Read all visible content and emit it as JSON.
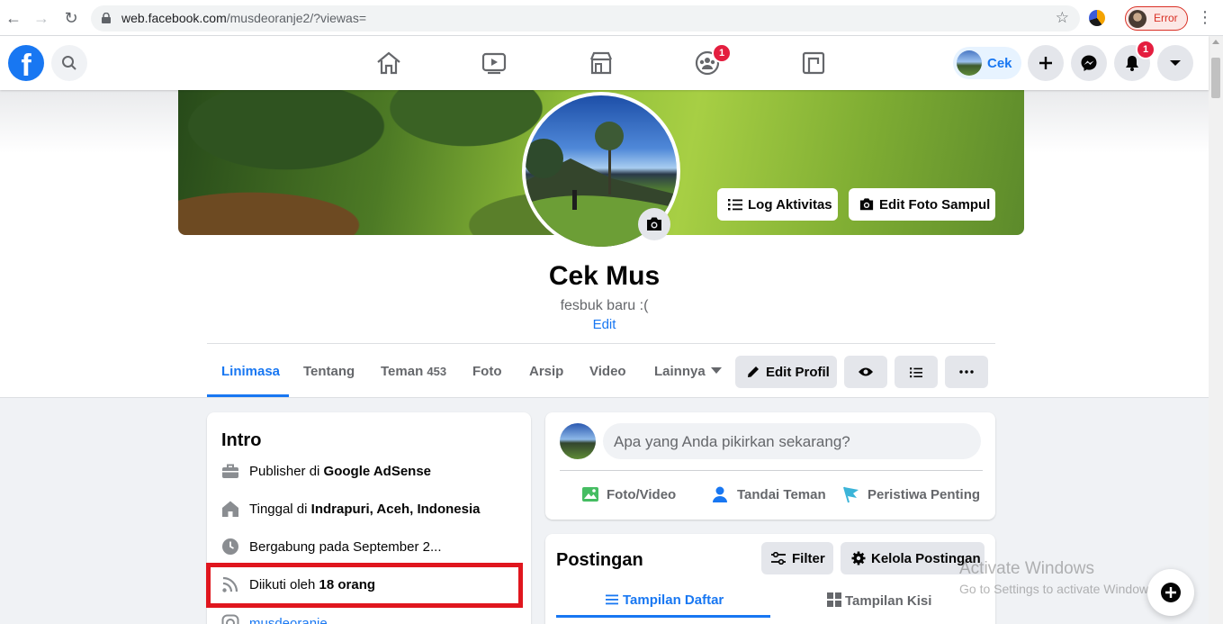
{
  "browser": {
    "url_host": "web.facebook.com",
    "url_path": "/musdeoranje2/?viewas=",
    "profile_status": "Error"
  },
  "topbar": {
    "groups_badge": "1",
    "user_chip_name": "Cek",
    "notifications_badge": "1"
  },
  "profile": {
    "name": "Cek Mus",
    "bio": "fesbuk baru :(",
    "bio_edit": "Edit",
    "cover_buttons": {
      "activity_log": "Log Aktivitas",
      "edit_cover": "Edit Foto Sampul"
    }
  },
  "tabs": {
    "timeline": "Linimasa",
    "about": "Tentang",
    "friends": "Teman",
    "friends_count": "453",
    "photos": "Foto",
    "archive": "Arsip",
    "video": "Video",
    "more": "Lainnya",
    "edit_profile": "Edit Profil"
  },
  "intro": {
    "title": "Intro",
    "work_prefix": "Publisher di ",
    "work_value": "Google AdSense",
    "lives_prefix": "Tinggal di ",
    "lives_value": "Indrapuri, Aceh, Indonesia",
    "joined": "Bergabung pada September 2...",
    "followers_prefix": "Diikuti oleh ",
    "followers_value": "18 orang",
    "instagram": "musdeoranje"
  },
  "composer": {
    "placeholder": "Apa yang Anda pikirkan sekarang?",
    "photo_video": "Foto/Video",
    "tag_friends": "Tandai Teman",
    "life_event": "Peristiwa Penting"
  },
  "posts": {
    "title": "Postingan",
    "filter": "Filter",
    "manage": "Kelola Postingan",
    "list_view": "Tampilan Daftar",
    "grid_view": "Tampilan Kisi"
  },
  "watermark": {
    "line1": "Activate Windows",
    "line2": "Go to Settings to activate Windows."
  },
  "colors": {
    "brand": "#1877f2",
    "badge": "#e41e3f",
    "highlight": "#e0161e"
  }
}
